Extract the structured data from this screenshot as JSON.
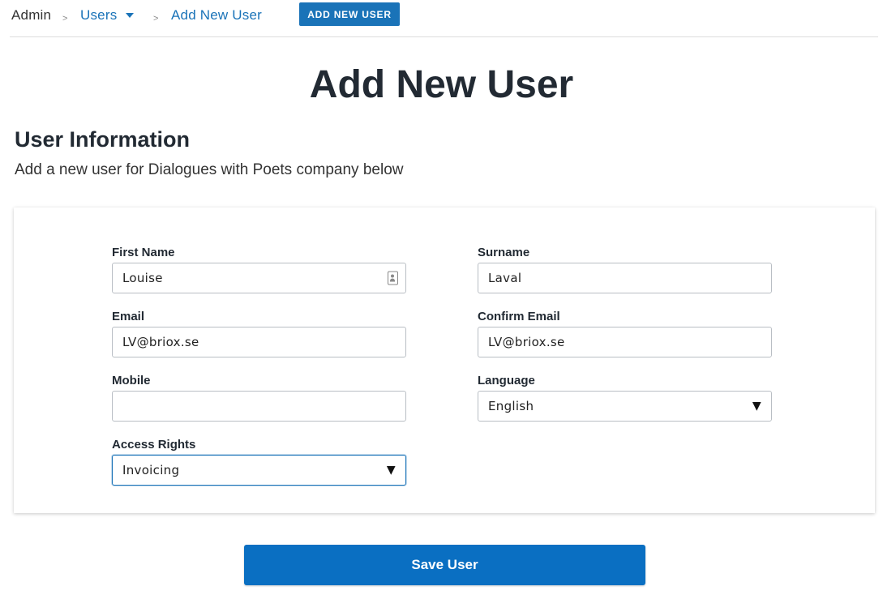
{
  "breadcrumb": {
    "root": "Admin",
    "separator": ">",
    "parent": "Users",
    "current": "Add New User"
  },
  "header": {
    "add_button_label": "ADD NEW USER"
  },
  "page": {
    "title": "Add New User",
    "section_title": "User Information",
    "section_subtitle": "Add a new user for Dialogues with Poets company below"
  },
  "form": {
    "first_name": {
      "label": "First Name",
      "value": "Louise"
    },
    "surname": {
      "label": "Surname",
      "value": "Laval"
    },
    "email": {
      "label": "Email",
      "value": "LV@briox.se"
    },
    "confirm_email": {
      "label": "Confirm Email",
      "value": "LV@briox.se"
    },
    "mobile": {
      "label": "Mobile",
      "value": ""
    },
    "language": {
      "label": "Language",
      "value": "English",
      "arrow": "▼"
    },
    "access_rights": {
      "label": "Access Rights",
      "value": "Invoicing",
      "arrow": "▼"
    }
  },
  "actions": {
    "save_label": "Save User"
  },
  "colors": {
    "accent": "#1a73b8",
    "save_button": "#0a6fc2",
    "text": "#222a33"
  },
  "icons": {
    "users_dropdown": "chevron-down-icon",
    "autofill": "contact-card-icon",
    "select_arrow": "caret-down-icon"
  }
}
